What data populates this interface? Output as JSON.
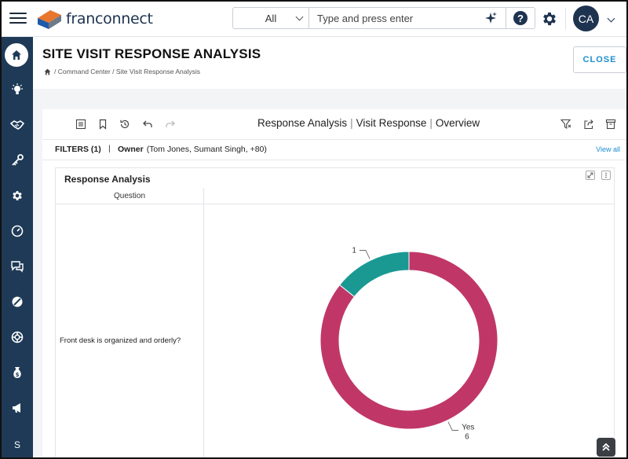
{
  "header": {
    "logo_text": "franconnect",
    "search": {
      "scope": "All",
      "placeholder": "Type and press enter"
    },
    "help_label": "?",
    "avatar_initials": "CA"
  },
  "sidebar": {
    "items": [
      {
        "icon": "home-icon"
      },
      {
        "icon": "lightbulb-icon"
      },
      {
        "icon": "handshake-icon"
      },
      {
        "icon": "key-icon"
      },
      {
        "icon": "gear-icon"
      },
      {
        "icon": "gauge-icon"
      },
      {
        "icon": "chat-icon"
      },
      {
        "icon": "pie-icon"
      },
      {
        "icon": "lifebuoy-icon"
      },
      {
        "icon": "money-bag-icon"
      },
      {
        "icon": "megaphone-icon"
      }
    ],
    "bottom_label": "S"
  },
  "page": {
    "title": "SITE VISIT RESPONSE ANALYSIS",
    "breadcrumb": "/ Command Center / Site Visit Response Analysis",
    "close_label": "CLOSE"
  },
  "toolbar": {
    "title_parts": [
      "Response Analysis",
      "Visit Response",
      "Overview"
    ],
    "separator": "|"
  },
  "filters": {
    "label": "FILTERS (1)",
    "separator": "|",
    "owner_label": "Owner",
    "owner_value": "(Tom Jones, Sumant Singh, +80)",
    "view_all": "View all"
  },
  "panel": {
    "title": "Response Analysis",
    "column_header": "Question",
    "question": "Front desk is organized and orderly?"
  },
  "chart_data": {
    "type": "pie",
    "donut": true,
    "slices": [
      {
        "label": "Yes",
        "value": 6,
        "color": "#c03767"
      },
      {
        "label": "",
        "value": 1,
        "color": "#1a9993"
      }
    ]
  },
  "colors": {
    "sidebar": "#1e3a57",
    "accent": "#1d8ed1",
    "brand_dark": "#1e3350"
  }
}
